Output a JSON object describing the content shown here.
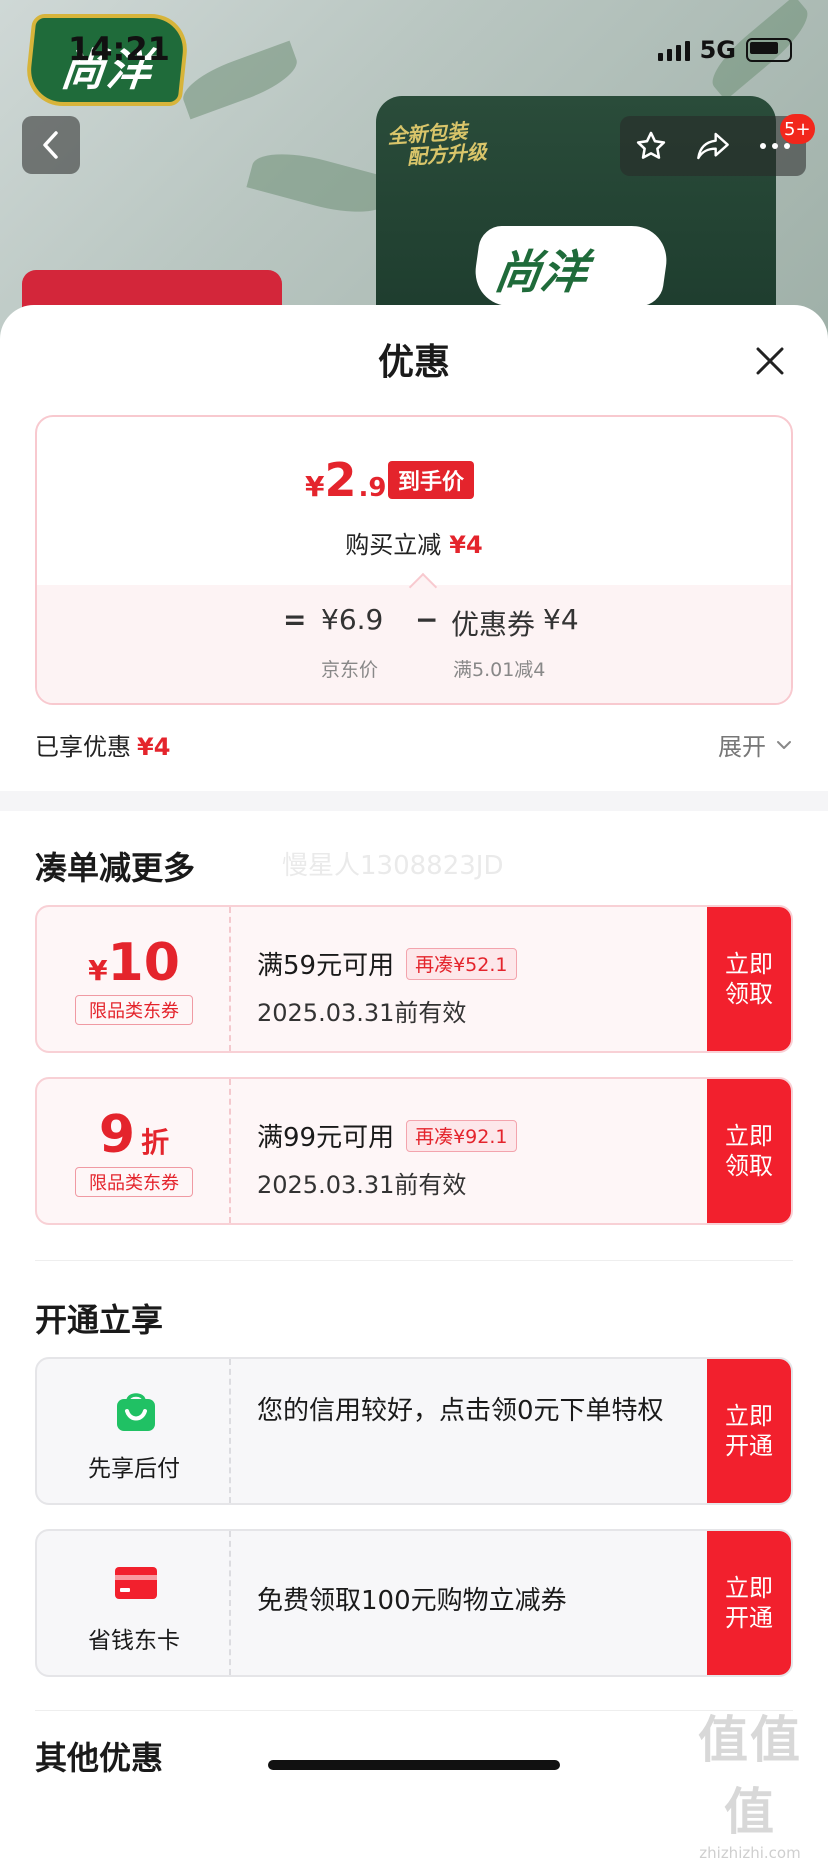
{
  "status_bar": {
    "time": "14:21",
    "network": "5G"
  },
  "nav": {
    "badge": "5+"
  },
  "background": {
    "brand_logo_text": "尚洋",
    "bag_promo_line1": "全新包装",
    "bag_promo_line2": "配方升级",
    "bag_logo_text": "尚洋"
  },
  "sheet": {
    "title": "优惠",
    "summary": {
      "final_currency": "¥",
      "final_int": "2",
      "final_dec": ".9",
      "final_tag": "到手价",
      "instant_label": "购买立减",
      "instant_amount": "¥4",
      "eq": "=",
      "jd_price": "¥6.9",
      "minus": "−",
      "coupon_label": "优惠券",
      "coupon_amount": "¥4",
      "jd_price_label": "京东价",
      "coupon_rule": "满5.01减4"
    },
    "enjoyed_label": "已享优惠",
    "enjoyed_amount": "¥4",
    "expand_label": "展开"
  },
  "section_more": {
    "title": "凑单减更多",
    "watermark": "慢星人1308823JD",
    "coupons": [
      {
        "currency": "¥",
        "value": "10",
        "unit": "",
        "type": "限品类东券",
        "condition": "满59元可用",
        "gap": "再凑¥52.1",
        "expire": "2025.03.31前有效",
        "action": "立即领取"
      },
      {
        "currency": "",
        "value": "9",
        "unit": "折",
        "type": "限品类东券",
        "condition": "满99元可用",
        "gap": "再凑¥92.1",
        "expire": "2025.03.31前有效",
        "action": "立即领取"
      }
    ]
  },
  "section_open": {
    "title": "开通立享",
    "services": [
      {
        "name": "先享后付",
        "icon": "shopping-bag-icon",
        "desc": "您的信用较好，点击领0元下单特权",
        "action": "立即开通"
      },
      {
        "name": "省钱东卡",
        "icon": "card-icon",
        "desc": "免费领取100元购物立减券",
        "action": "立即开通"
      }
    ]
  },
  "section_other": {
    "title": "其他优惠"
  },
  "corner_watermark": {
    "big": "值值值",
    "small": "zhizhizhi.com"
  },
  "colors": {
    "accent_red": "#e4242c",
    "action_red": "#f2202d",
    "green_icon": "#20c164"
  }
}
